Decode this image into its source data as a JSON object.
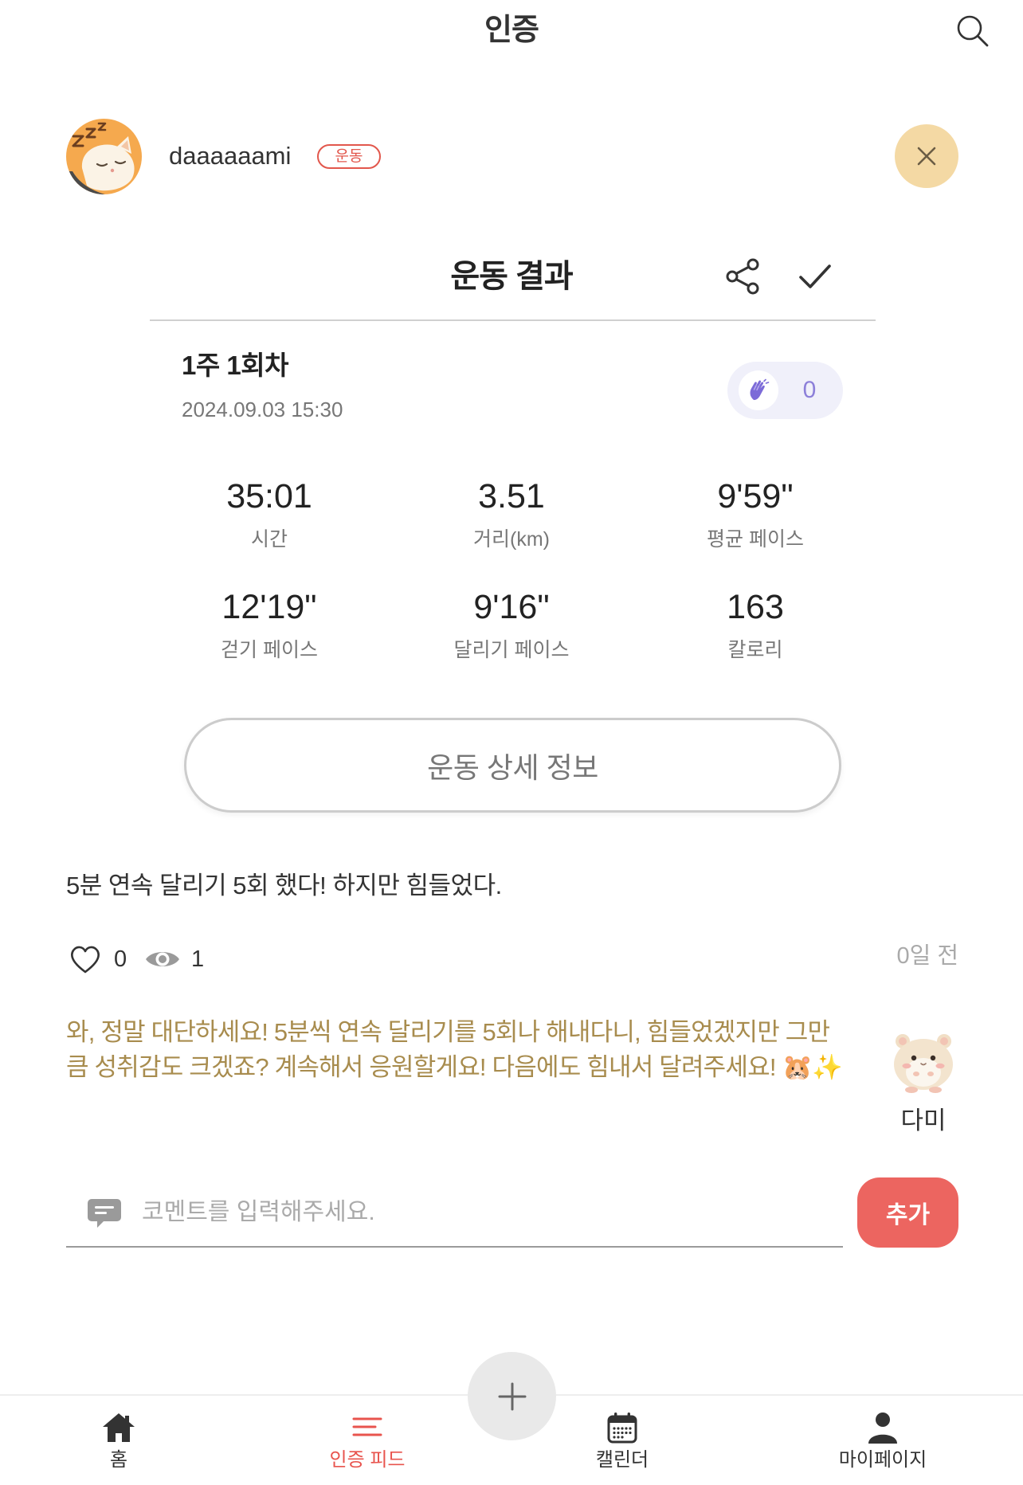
{
  "colors": {
    "accent": "#EC6560",
    "nav_active": "#E8544E",
    "ai_comment_text": "#A88C4E",
    "clap_count": "#8C7FD9",
    "close_button_bg": "#F4D9A4",
    "badge": "#E2574C"
  },
  "header": {
    "title": "인증",
    "search_icon": "search-icon"
  },
  "post": {
    "author": {
      "avatar_icon": "sleeping-cat-avatar",
      "username": "daaaaaami",
      "category_badge": "운동"
    },
    "close_icon": "close-icon",
    "result_card": {
      "title": "운동 결과",
      "share_icon": "share-icon",
      "confirm_icon": "check-icon",
      "session": "1주 1회차",
      "datetime": "2024.09.03 15:30",
      "clap": {
        "icon": "clap-icon",
        "count": "0"
      },
      "stats": [
        {
          "value": "35:01",
          "label": "시간"
        },
        {
          "value": "3.51",
          "label": "거리(km)"
        },
        {
          "value": "9'59\"",
          "label": "평균 페이스"
        },
        {
          "value": "12'19\"",
          "label": "걷기 페이스"
        },
        {
          "value": "9'16\"",
          "label": "달리기 페이스"
        },
        {
          "value": "163",
          "label": "칼로리"
        }
      ],
      "detail_button_label": "운동 상세 정보"
    },
    "body": "5분 연속 달리기 5회 했다! 하지만 힘들었다.",
    "reactions": {
      "like_icon": "heart-icon",
      "likes": "0",
      "view_icon": "eye-icon",
      "views": "1"
    },
    "time_ago": "0일 전"
  },
  "ai_comment": {
    "text": "와, 정말 대단하세요! 5분씩 연속 달리기를 5회나 해내다니, 힘들었겠지만 그만큼 성취감도 크겠죠? 계속해서 응원할게요! 다음에도 힘내서 달려주세요! 🐹✨",
    "author_name": "다미",
    "avatar_icon": "hamster-avatar"
  },
  "comment_form": {
    "icon": "comment-icon",
    "placeholder": "코멘트를 입력해주세요.",
    "submit_label": "추가"
  },
  "fab": {
    "icon": "plus-icon"
  },
  "nav": {
    "items": [
      {
        "icon": "home-icon",
        "label": "홈",
        "active": false
      },
      {
        "icon": "feed-icon",
        "label": "인증 피드",
        "active": true
      },
      {
        "icon": "calendar-icon",
        "label": "캘린더",
        "active": false
      },
      {
        "icon": "person-icon",
        "label": "마이페이지",
        "active": false
      }
    ]
  }
}
